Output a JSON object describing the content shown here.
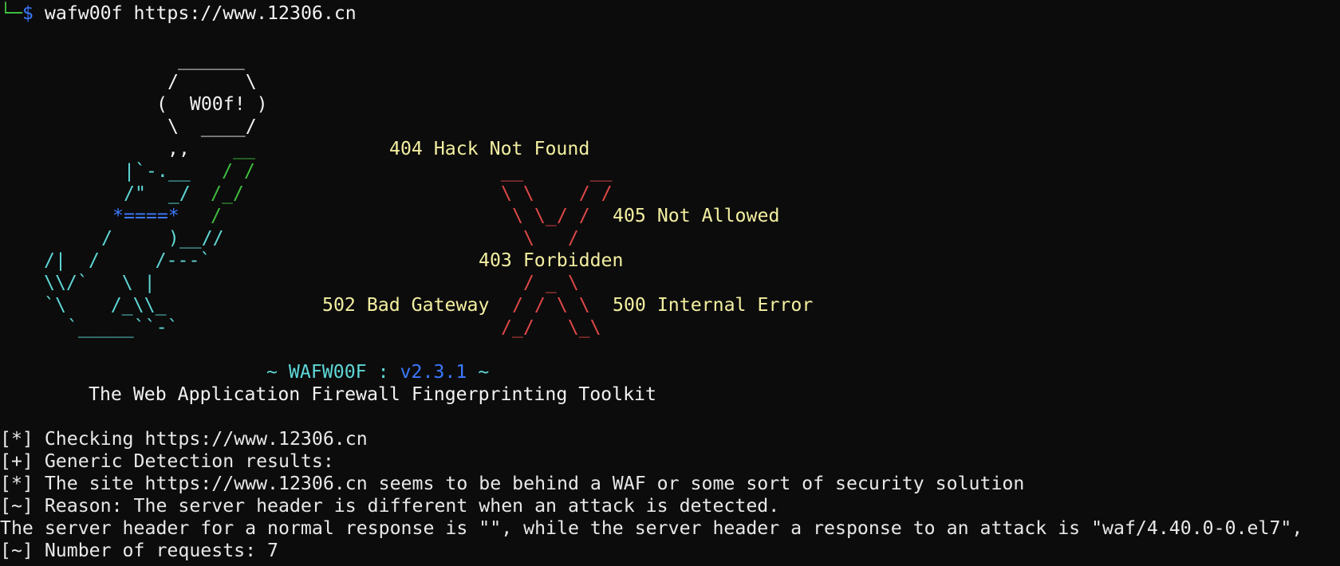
{
  "prompt": {
    "corner": "└─",
    "symbol": "$",
    "command": "wafw00f https://www.12306.cn"
  },
  "banner": {
    "bubble": [
      "______",
      "/      \\",
      "(  W00f! )",
      "\\  ____/"
    ],
    "dog": [
      ",,",
      "|`-.__",
      "/\"  _/",
      "*====*",
      "/     )__//",
      "/|  /     /---`",
      "\\\\/`   \\ |",
      "`\\    /_\\\\_",
      "`_____``-`"
    ],
    "leash": [
      "__",
      "/ /",
      "/_/",
      "/"
    ],
    "cross": [
      "__      __",
      "\\ \\    / /",
      "\\ \\_/ /",
      "\\   /",
      "/ _ \\",
      "/ / \\ \\",
      "/_/   \\_\\"
    ],
    "errors": {
      "e404": "404 Hack Not Found",
      "e405": "405 Not Allowed",
      "e403": "403 Forbidden",
      "e502": "502 Bad Gateway",
      "e500": "500 Internal Error"
    },
    "version_prefix": "~ WAFW00F :",
    "version": "v2.3.1",
    "version_suffix": "~",
    "tagline": "The Web Application Firewall Fingerprinting Toolkit"
  },
  "output": [
    "[*] Checking https://www.12306.cn",
    "[+] Generic Detection results:",
    "[*] The site https://www.12306.cn seems to be behind a WAF or some sort of security solution",
    "[~] Reason: The server header is different when an attack is detected.",
    "The server header for a normal response is \"\", while the server header a response to an attack is \"waf/4.40.0-0.el7\",",
    "[~] Number of requests: 7"
  ],
  "colors": {
    "background": "#0c0c0c",
    "text": "#e8e8e8",
    "cyan": "#5fd7d7",
    "green": "#3fbf3f",
    "blue": "#3b78ff",
    "red": "#e04848",
    "yellow": "#f3efa1"
  }
}
